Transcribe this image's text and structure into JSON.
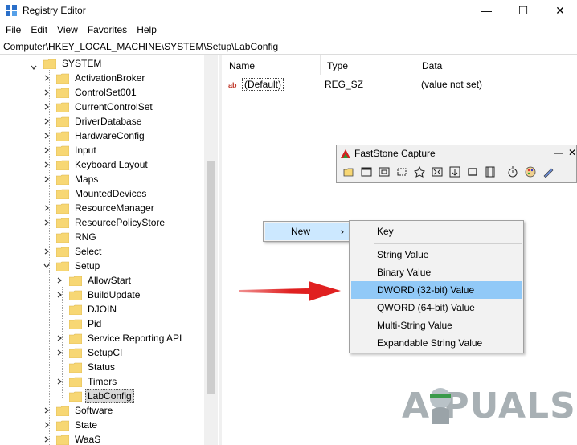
{
  "window": {
    "title": "Registry Editor",
    "min_glyph": "—",
    "max_glyph": "☐",
    "close_glyph": "✕"
  },
  "menu": [
    "File",
    "Edit",
    "View",
    "Favorites",
    "Help"
  ],
  "address": "Computer\\HKEY_LOCAL_MACHINE\\SYSTEM\\Setup\\LabConfig",
  "tree": {
    "system": "SYSTEM",
    "system_children": [
      "ActivationBroker",
      "ControlSet001",
      "CurrentControlSet",
      "DriverDatabase",
      "HardwareConfig",
      "Input",
      "Keyboard Layout",
      "Maps",
      "MountedDevices",
      "ResourceManager",
      "ResourcePolicyStore",
      "RNG",
      "Select"
    ],
    "setup": "Setup",
    "setup_children": [
      "AllowStart",
      "BuildUpdate",
      "DJOIN",
      "Pid",
      "Service Reporting API",
      "SetupCI",
      "Status",
      "Timers",
      "LabConfig"
    ],
    "after_setup": [
      "Software",
      "State",
      "WaaS"
    ]
  },
  "list": {
    "headers": [
      "Name",
      "Type",
      "Data"
    ],
    "rows": [
      {
        "name": "(Default)",
        "type": "REG_SZ",
        "data": "(value not set)",
        "icon": "string-value-icon"
      }
    ]
  },
  "faststone": {
    "title": "FastStone Capture",
    "min_glyph": "—",
    "close_glyph": "✕",
    "tools": [
      "open-icon",
      "capture-window-icon",
      "capture-object-icon",
      "capture-rectangle-icon",
      "capture-freehand-icon",
      "capture-fullscreen-icon",
      "capture-scrolling-icon",
      "capture-fixed-region-icon",
      "screen-recorder-icon",
      "delay-timer-icon",
      "output-palette-icon",
      "settings-icon"
    ]
  },
  "context_menu": {
    "new_label": "New",
    "submenu": [
      "Key",
      "String Value",
      "Binary Value",
      "DWORD (32-bit) Value",
      "QWORD (64-bit) Value",
      "Multi-String Value",
      "Expandable String Value"
    ],
    "highlighted": "DWORD (32-bit) Value"
  },
  "watermark": "A  PUALS",
  "colors": {
    "folder": "#f7d774",
    "highlight": "#91c9f7",
    "menu_hover": "#cce8ff",
    "arrow": "#e02020"
  }
}
